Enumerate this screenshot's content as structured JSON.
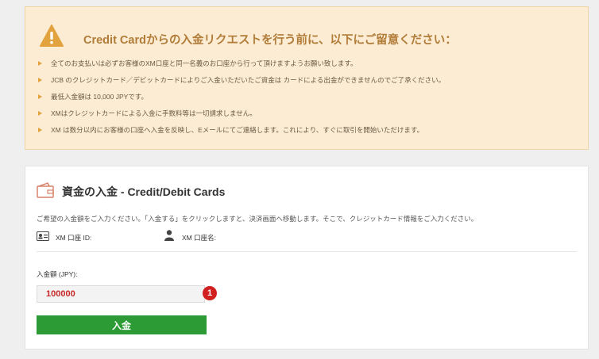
{
  "notice": {
    "icon": "warning-icon",
    "accent_color": "#e2a33e",
    "title": "Credit Cardからの入金リクエストを行う前に、以下にご留意ください：",
    "items": [
      "全てのお支払いは必ずお客様のXM口座と同一名義のお口座から行って頂けますようお願い致します。",
      "JCB のクレジットカード／デビットカードによりご入金いただいたご資金は カードによる出金ができませんのでご了承ください。",
      "最低入金額は 10,000 JPYです。",
      "XMはクレジットカードによる入金に手数料等は一切請求しません。",
      "XM は数分以内にお客様の口座へ入金を反映し、Eメールにてご連絡します。これにより、すぐに取引を開始いただけます。"
    ]
  },
  "deposit": {
    "icon": "wallet-icon",
    "title": "資金の入金 - Credit/Debit Cards",
    "description": "ご希望の入金額をご入力ください。「入金する」をクリックしますと、決済画面へ移動します。そこで、クレジットカード情報をご入力ください。",
    "account_id_label": "XM 口座 ID:",
    "account_name_label": "XM 口座名:",
    "amount_label": "入金額 (JPY):",
    "amount_value": "100000",
    "step_badge": "1",
    "submit_label": "入金",
    "button_color": "#2c9b35"
  }
}
